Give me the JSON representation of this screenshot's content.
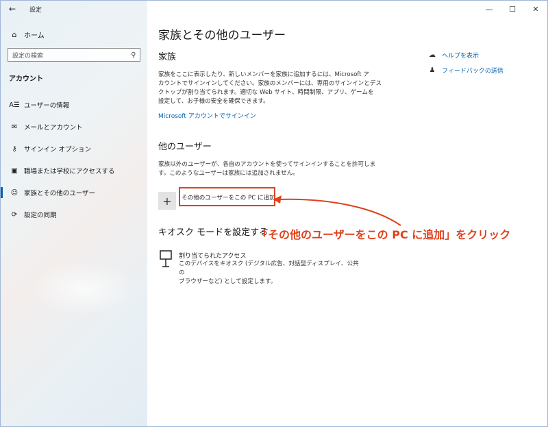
{
  "window": {
    "app_title": "設定",
    "controls": {
      "minimize": "—",
      "maximize": "☐",
      "close": "✕"
    }
  },
  "sidebar": {
    "back": "←",
    "home_label": "ホーム",
    "search_placeholder": "設定の検索",
    "section": "アカウント",
    "items": [
      {
        "icon": "user-info-icon",
        "label": "ユーザーの情報",
        "active": false
      },
      {
        "icon": "mail-icon",
        "label": "メールとアカウント",
        "active": false
      },
      {
        "icon": "key-icon",
        "label": "サインイン オプション",
        "active": false
      },
      {
        "icon": "briefcase-icon",
        "label": "職場または学校にアクセスする",
        "active": false
      },
      {
        "icon": "person-icon",
        "label": "家族とその他のユーザー",
        "active": true
      },
      {
        "icon": "sync-icon",
        "label": "設定の同期",
        "active": false
      }
    ]
  },
  "main": {
    "title": "家族とその他のユーザー",
    "family": {
      "heading": "家族",
      "description_lines": [
        "家族をここに表示したり、新しいメンバーを家族に追加するには、Microsoft ア",
        "カウントでサインインしてください。家族のメンバーには、専用のサインインとデス",
        "クトップが割り当てられます。適切な Web サイト、時間制限、アプリ、ゲームを",
        "設定して、お子様の安全を確保できます。"
      ],
      "link": "Microsoft アカウントでサインイン"
    },
    "other_users": {
      "heading": "他のユーザー",
      "description_lines": [
        "家族以外のユーザーが、各自のアカウントを使ってサインインすることを許可しま",
        "す。このようなユーザーは家族には追加されません。"
      ],
      "add_button_icon": "+",
      "add_label": "その他のユーザーをこの PC に追加"
    },
    "kiosk": {
      "heading": "キオスク モードを設定する",
      "title": "割り当てられたアクセス",
      "description_lines": [
        "このデバイスをキオスク (デジタル広告、対話型ディスプレイ、公共の",
        "ブラウザーなど) として設定します。"
      ]
    },
    "help": {
      "items": [
        {
          "icon": "help-chat-icon",
          "label": "ヘルプを表示"
        },
        {
          "icon": "feedback-icon",
          "label": "フィードバックの送信"
        }
      ]
    },
    "annotation": "「その他のユーザーをこの PC に追加」をクリック"
  },
  "colors": {
    "accent": "#0063b1",
    "annotation": "#e0411c"
  }
}
